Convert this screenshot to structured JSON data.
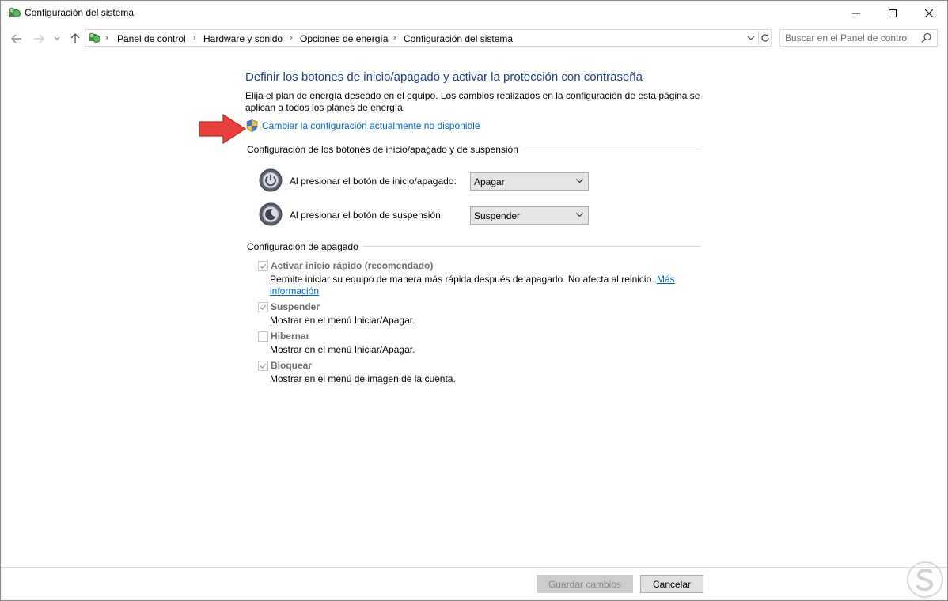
{
  "window": {
    "title": "Configuración del sistema"
  },
  "address_bar": {
    "breadcrumbs": [
      "Panel de control",
      "Hardware y sonido",
      "Opciones de energía",
      "Configuración del sistema"
    ]
  },
  "search": {
    "placeholder": "Buscar en el Panel de control"
  },
  "main": {
    "heading": "Definir los botones de inicio/apagado y activar la protección con contraseña",
    "description": "Elija el plan de energía deseado en el equipo. Los cambios realizados en la configuración de esta página se aplican a todos los planes de energía.",
    "change_link": "Cambiar la configuración actualmente no disponible",
    "buttons_group": {
      "title": "Configuración de los botones de inicio/apagado y de suspensión",
      "power_label": "Al presionar el botón de inicio/apagado:",
      "power_value": "Apagar",
      "sleep_label": "Al presionar el botón de suspensión:",
      "sleep_value": "Suspender"
    },
    "shutdown_group": {
      "title": "Configuración de apagado",
      "items": [
        {
          "label": "Activar inicio rápido (recomendado)",
          "desc": "Permite iniciar su equipo de manera más rápida después de apagarlo. No afecta al reinicio.",
          "link": "Más información",
          "checked": true
        },
        {
          "label": "Suspender",
          "desc": "Mostrar en el menú Iniciar/Apagar.",
          "checked": true
        },
        {
          "label": "Hibernar",
          "desc": "Mostrar en el menú Iniciar/Apagar.",
          "checked": false
        },
        {
          "label": "Bloquear",
          "desc": "Mostrar en el menú de imagen de la cuenta.",
          "checked": true
        }
      ]
    }
  },
  "footer": {
    "save_label": "Guardar cambios",
    "cancel_label": "Cancelar"
  },
  "colors": {
    "heading": "#1e3f8a",
    "link": "#0066cc",
    "arrow": "#e8403a"
  },
  "icons": [
    "control-panel-icon",
    "back-arrow-icon",
    "forward-arrow-icon",
    "chevron-down-icon",
    "up-arrow-icon",
    "refresh-icon",
    "search-icon",
    "shield-icon",
    "power-icon",
    "sleep-icon",
    "red-arrow-annotation",
    "watermark-logo"
  ]
}
